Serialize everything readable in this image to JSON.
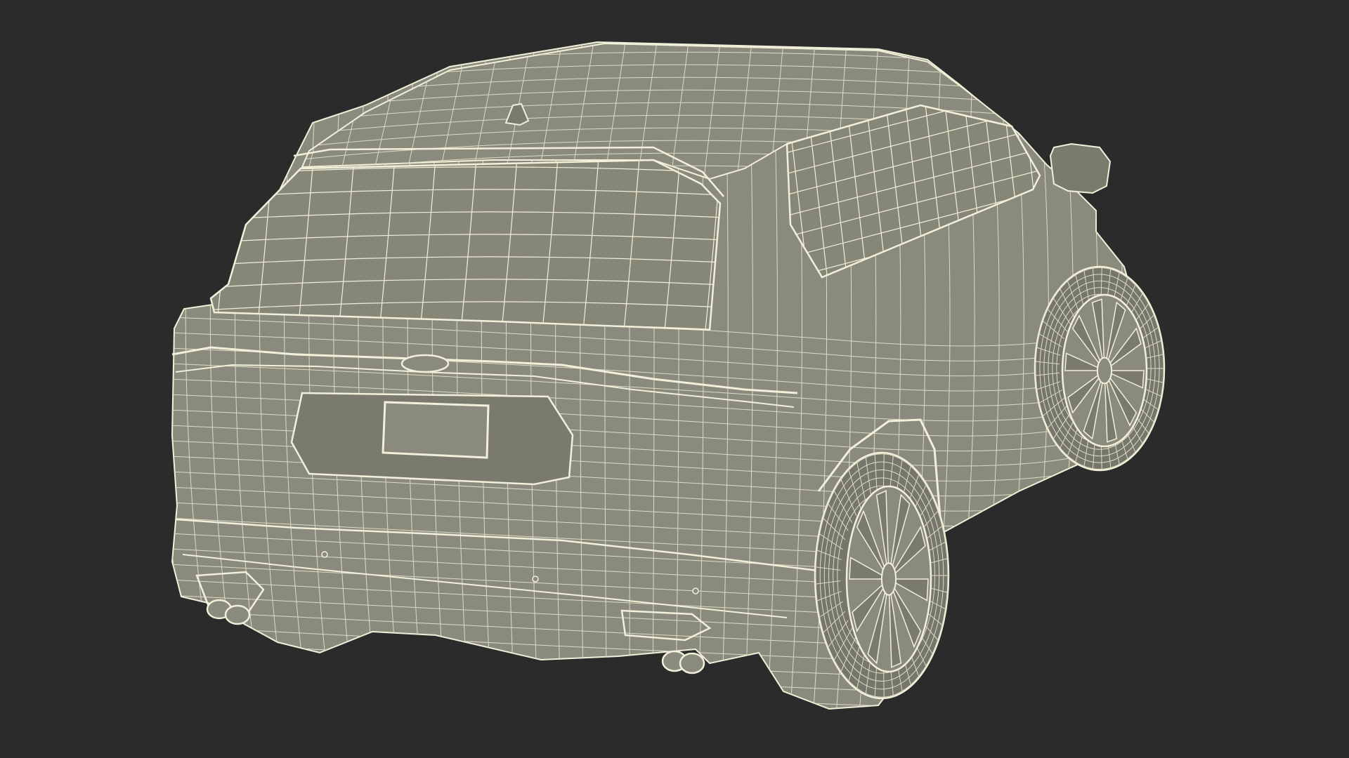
{
  "scene": {
    "subject": "suv-wireframe-rear-three-quarter",
    "colors": {
      "background": "#2b2b2b",
      "body_fill": "#8a8b7c",
      "body_fill_dark": "#7a7b6d",
      "glass_fill": "#868777",
      "tire_fill": "#76776a",
      "wire": "#f1f0da",
      "wire_dim": "#dcdcc4"
    }
  }
}
